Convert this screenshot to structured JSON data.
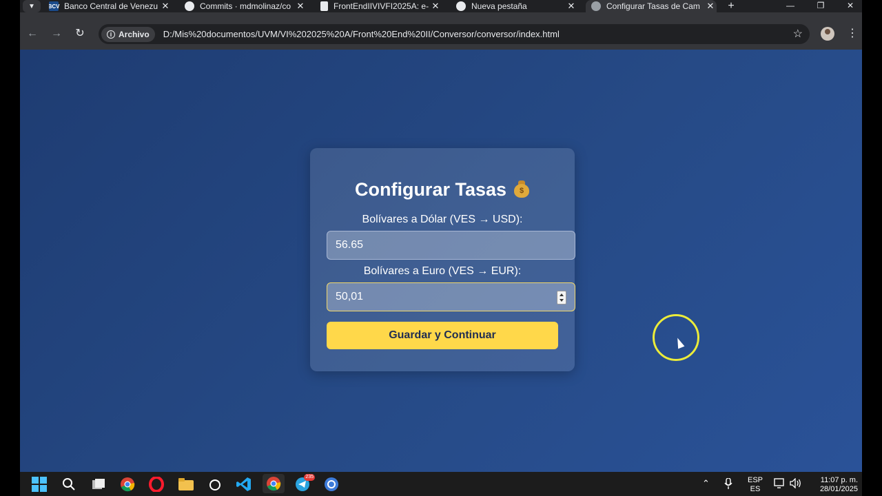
{
  "browser": {
    "tabs": [
      {
        "title": "Banco Central de Venezu",
        "favicon": "BCV"
      },
      {
        "title": "Commits · mdmolinaz/co",
        "favicon": "github-icon"
      },
      {
        "title": "FrontEndIIVIVFI2025A: e-",
        "favicon": "document-icon"
      },
      {
        "title": "Nueva pestaña",
        "favicon": "chrome-icon"
      },
      {
        "title": "Configurar Tasas de Cam",
        "favicon": "globe-icon",
        "active": true
      }
    ],
    "address_chip": "Archivo",
    "url": "D:/Mis%20documentos/UVM/VI%202025%20A/Front%20End%20II/Conversor/conversor/index.html"
  },
  "form": {
    "title": "Configurar Tasas",
    "usd_label": "Bolívares a Dólar (VES → USD):",
    "usd_value": "56.65",
    "eur_label": "Bolívares a Euro (VES → EUR):",
    "eur_value": "50,01",
    "submit_label": "Guardar y Continuar"
  },
  "taskbar": {
    "language_top": "ESP",
    "language_bottom": "ES",
    "time": "11:07 p. m.",
    "date": "28/01/2025",
    "telegram_badge": "235"
  },
  "colors": {
    "page_background": "#1e3c72",
    "accent_button": "#ffd84a"
  }
}
